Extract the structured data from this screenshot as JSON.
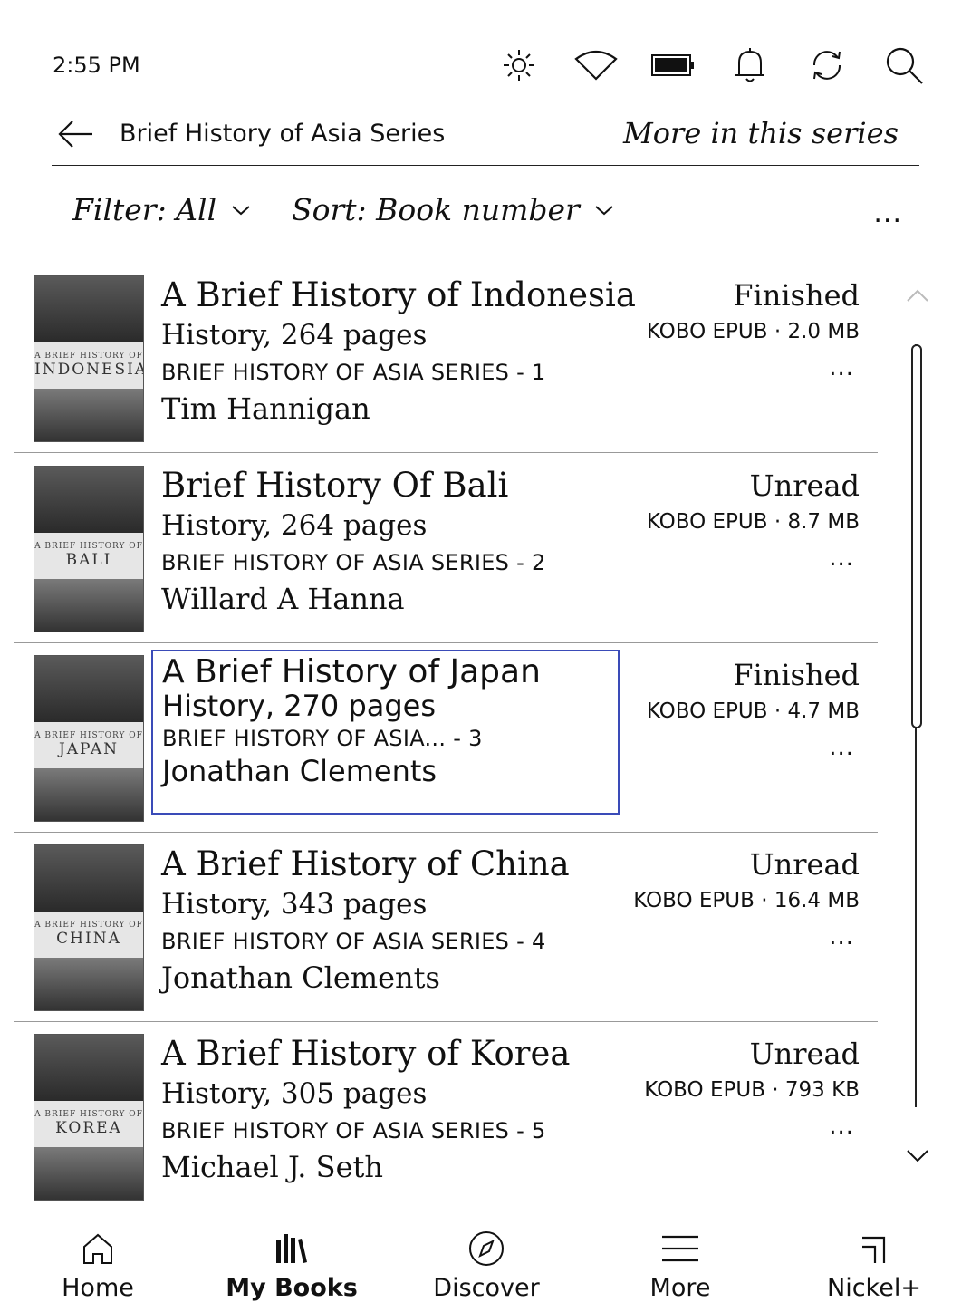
{
  "status_bar": {
    "time": "2:55 PM",
    "icons": [
      "brightness-icon",
      "wifi-icon",
      "battery-icon",
      "notification-icon",
      "sync-icon",
      "search-icon"
    ]
  },
  "header": {
    "title": "Brief History of Asia Series",
    "more_link": "More in this series"
  },
  "toolbar": {
    "filter_label": "Filter: All",
    "sort_label": "Sort: Book number",
    "menu": "..."
  },
  "books": [
    {
      "title": "A Brief History of Indonesia",
      "meta": "History, 264 pages",
      "series": "BRIEF HISTORY OF ASIA SERIES - 1",
      "author": "Tim Hannigan",
      "status": "Finished",
      "format": "KOBO EPUB · 2.0 MB",
      "cover_word": "INDONESIA",
      "cover_small": "A BRIEF HISTORY OF",
      "selected": false
    },
    {
      "title": "Brief History Of Bali",
      "meta": "History, 264 pages",
      "series": "BRIEF HISTORY OF ASIA SERIES - 2",
      "author": "Willard A Hanna",
      "status": "Unread",
      "format": "KOBO EPUB · 8.7 MB",
      "cover_word": "BALI",
      "cover_small": "A BRIEF HISTORY OF",
      "selected": false
    },
    {
      "title": "A Brief History of Japan",
      "meta": "History, 270 pages",
      "series": "BRIEF HISTORY OF ASIA... - 3",
      "author": "Jonathan Clements",
      "status": "Finished",
      "format": "KOBO EPUB · 4.7 MB",
      "cover_word": "JAPAN",
      "cover_small": "A BRIEF HISTORY OF",
      "selected": true
    },
    {
      "title": "A Brief History of China",
      "meta": "History, 343 pages",
      "series": "BRIEF HISTORY OF ASIA SERIES - 4",
      "author": "Jonathan Clements",
      "status": "Unread",
      "format": "KOBO EPUB · 16.4 MB",
      "cover_word": "CHINA",
      "cover_small": "A BRIEF HISTORY OF",
      "selected": false
    },
    {
      "title": "A Brief History of Korea",
      "meta": "History, 305 pages",
      "series": "BRIEF HISTORY OF ASIA SERIES - 5",
      "author": "Michael J. Seth",
      "status": "Unread",
      "format": "KOBO EPUB · 793 KB",
      "cover_word": "KOREA",
      "cover_small": "A BRIEF HISTORY OF",
      "selected": false
    }
  ],
  "row_menu": "...",
  "nav": [
    {
      "label": "Home",
      "icon": "home-icon",
      "active": false
    },
    {
      "label": "My Books",
      "icon": "books-icon",
      "active": true
    },
    {
      "label": "Discover",
      "icon": "compass-icon",
      "active": false
    },
    {
      "label": "More",
      "icon": "menu-icon",
      "active": false
    },
    {
      "label": "Nickel+",
      "icon": "nickel-icon",
      "active": false
    }
  ]
}
